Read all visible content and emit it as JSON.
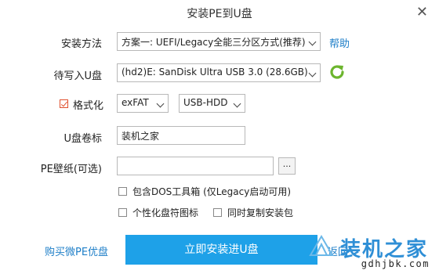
{
  "window": {
    "title": "安装PE到U盘",
    "close_glyph": "✕"
  },
  "form": {
    "method": {
      "label": "安装方法",
      "value": "方案一: UEFI/Legacy全能三分区方式(推荐)",
      "help_link": "帮助"
    },
    "target": {
      "label": "待写入U盘",
      "value": "(hd2)E: SanDisk Ultra USB 3.0 (28.6GB)"
    },
    "format": {
      "label": "格式化",
      "checked": true,
      "fs": "exFAT",
      "mode": "USB-HDD"
    },
    "volume": {
      "label": "U盘卷标",
      "value": "装机之家"
    },
    "wallpaper": {
      "label": "PE壁纸(可选)",
      "value": "",
      "browse": "..."
    },
    "options": [
      {
        "label": "包含DOS工具箱 (仅Legacy启动可用)",
        "checked": false
      },
      {
        "label": "个性化盘符图标",
        "checked": false
      },
      {
        "label": "同时复制安装包",
        "checked": false
      }
    ]
  },
  "footer": {
    "buy_link": "购买微PE优盘",
    "install_button": "立即安装进U盘",
    "back_link": "返回"
  },
  "watermark": {
    "text": "装机之家",
    "url": "gdhjbk.com"
  },
  "colors": {
    "accent": "#1ea1e8",
    "link": "#1f7fc8",
    "refresh": "#6cb52d",
    "check": "#e0502e"
  },
  "icons": {
    "refresh": "refresh-icon",
    "close": "close-icon",
    "dropdown": "chevron-down-icon"
  }
}
